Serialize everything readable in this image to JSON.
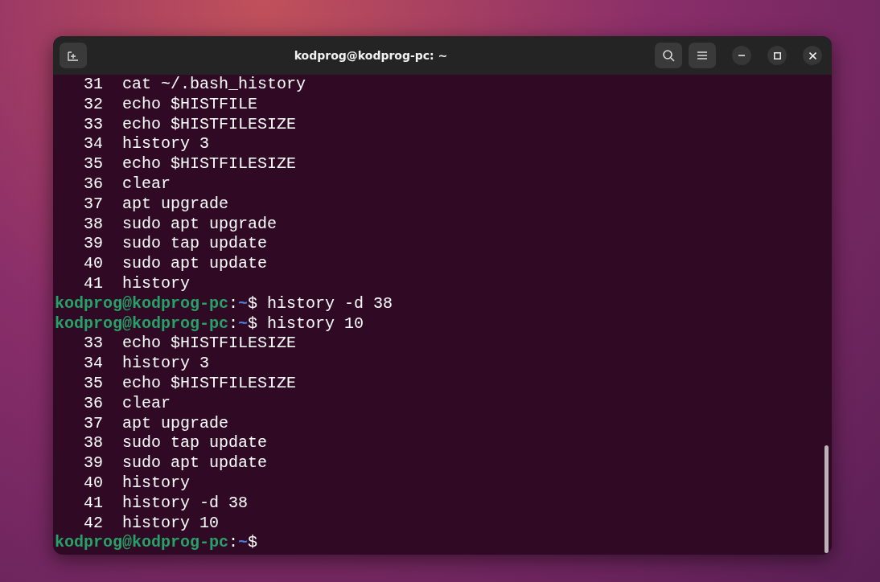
{
  "window": {
    "title": "kodprog@kodprog-pc: ~"
  },
  "lines": [
    {
      "kind": "output",
      "text": "   31  cat ~/.bash_history"
    },
    {
      "kind": "output",
      "text": "   32  echo $HISTFILE"
    },
    {
      "kind": "output",
      "text": "   33  echo $HISTFILESIZE"
    },
    {
      "kind": "output",
      "text": "   34  history 3"
    },
    {
      "kind": "output",
      "text": "   35  echo $HISTFILESIZE"
    },
    {
      "kind": "output",
      "text": "   36  clear"
    },
    {
      "kind": "output",
      "text": "   37  apt upgrade"
    },
    {
      "kind": "output",
      "text": "   38  sudo apt upgrade"
    },
    {
      "kind": "output",
      "text": "   39  sudo tap update"
    },
    {
      "kind": "output",
      "text": "   40  sudo apt update"
    },
    {
      "kind": "output",
      "text": "   41  history"
    },
    {
      "kind": "prompt",
      "user": "kodprog@kodprog-pc",
      "sep": ":",
      "path": "~",
      "command": "$ history -d 38"
    },
    {
      "kind": "prompt",
      "user": "kodprog@kodprog-pc",
      "sep": ":",
      "path": "~",
      "command": "$ history 10"
    },
    {
      "kind": "output",
      "text": "   33  echo $HISTFILESIZE"
    },
    {
      "kind": "output",
      "text": "   34  history 3"
    },
    {
      "kind": "output",
      "text": "   35  echo $HISTFILESIZE"
    },
    {
      "kind": "output",
      "text": "   36  clear"
    },
    {
      "kind": "output",
      "text": "   37  apt upgrade"
    },
    {
      "kind": "output",
      "text": "   38  sudo tap update"
    },
    {
      "kind": "output",
      "text": "   39  sudo apt update"
    },
    {
      "kind": "output",
      "text": "   40  history"
    },
    {
      "kind": "output",
      "text": "   41  history -d 38"
    },
    {
      "kind": "output",
      "text": "   42  history 10"
    },
    {
      "kind": "prompt",
      "user": "kodprog@kodprog-pc",
      "sep": ":",
      "path": "~",
      "command": "$"
    }
  ]
}
